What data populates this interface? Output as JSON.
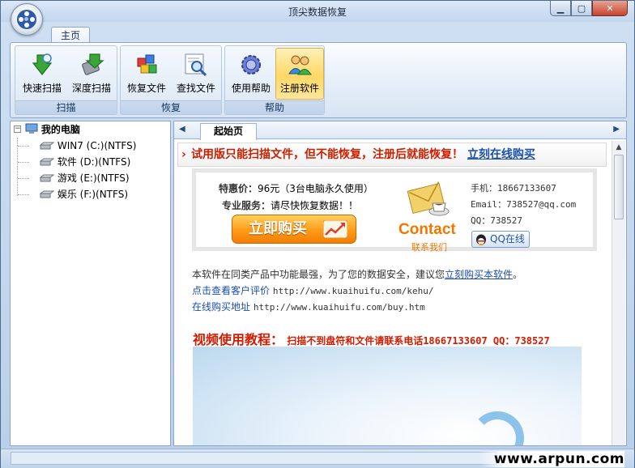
{
  "window": {
    "title": "顶尖数据恢复",
    "controls": {
      "minimize": "▁",
      "maximize": "▢",
      "close": "✕"
    }
  },
  "ribbon": {
    "tabs": [
      {
        "label": "主页",
        "selected": true
      }
    ],
    "groups": [
      {
        "label": "扫描",
        "buttons": [
          {
            "label": "快速扫描",
            "icon": "quick-scan-icon"
          },
          {
            "label": "深度扫描",
            "icon": "deep-scan-icon"
          }
        ]
      },
      {
        "label": "恢复",
        "buttons": [
          {
            "label": "恢复文件",
            "icon": "recover-files-icon"
          },
          {
            "label": "查找文件",
            "icon": "find-files-icon"
          }
        ]
      },
      {
        "label": "帮助",
        "buttons": [
          {
            "label": "使用帮助",
            "icon": "help-gear-icon"
          },
          {
            "label": "注册软件",
            "icon": "register-users-icon",
            "active": true
          }
        ]
      }
    ]
  },
  "tree": {
    "root": {
      "label": "我的电脑",
      "expanded": true,
      "expander": "−"
    },
    "drives": [
      {
        "label": "WIN7 (C:)(NTFS)"
      },
      {
        "label": "软件 (D:)(NTFS)"
      },
      {
        "label": "游戏 (E:)(NTFS)"
      },
      {
        "label": "娱乐 (F:)(NTFS)"
      }
    ]
  },
  "document": {
    "tab": "起始页",
    "notice": {
      "text": "试用版只能扫描文件，但不能恢复，注册后就能恢复！",
      "link": "立刻在线购买"
    },
    "promo": {
      "price_label": "特惠价：",
      "price_value": "96元（3台电脑永久使用）",
      "service_label": "专业服务：",
      "service_value": "请尽快恢复数据！！",
      "buy_button": "立即购买",
      "contact_word": "Contact",
      "contact_sub": "联系我们",
      "phone": "手机：18667133607",
      "email": "Email：738527@qq.com",
      "qq": "QQ：738527",
      "qq_button": "QQ在线"
    },
    "intro": {
      "text": "本软件在同类产品中功能最强，为了您的数据安全，建议您",
      "link": "立刻购买本软件",
      "tail": "。"
    },
    "review": {
      "label": "点击查看客户评价",
      "url": "http://www.kuaihuifu.com/kehu/"
    },
    "buy_online": {
      "label": "在线购买地址",
      "url": "http://www.kuaihuifu.com/buy.htm"
    },
    "video": {
      "title": "视频使用教程：",
      "subtitle": "扫描不到盘符和文件请联系电话18667133607 QQ：738527"
    }
  },
  "watermark": "www.arpun.com",
  "colors": {
    "accent": "#cc1f00",
    "link": "#1b4fb0",
    "ribbon": "#dbe7f5",
    "highlight": "#ffd866"
  }
}
